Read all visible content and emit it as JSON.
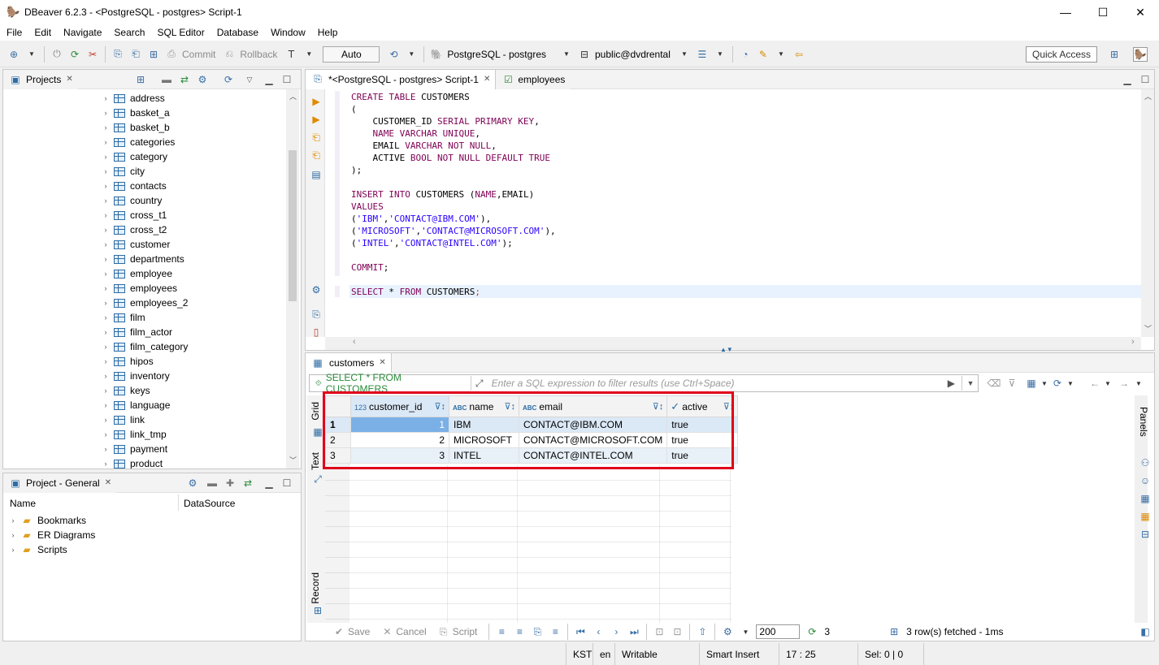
{
  "window": {
    "title": "DBeaver 6.2.3 - <PostgreSQL - postgres> Script-1",
    "minimize": "—",
    "maximize": "☐",
    "close": "✕"
  },
  "menu": [
    "File",
    "Edit",
    "Navigate",
    "Search",
    "SQL Editor",
    "Database",
    "Window",
    "Help"
  ],
  "toolbar": {
    "commit": "Commit",
    "rollback": "Rollback",
    "mode": "Auto",
    "connection": "PostgreSQL - postgres",
    "schema": "public@dvdrental",
    "quick_access": "Quick Access"
  },
  "projects_panel": {
    "tab": "Projects",
    "tables": [
      "address",
      "basket_a",
      "basket_b",
      "categories",
      "category",
      "city",
      "contacts",
      "country",
      "cross_t1",
      "cross_t2",
      "customer",
      "departments",
      "employee",
      "employees",
      "employees_2",
      "film",
      "film_actor",
      "film_category",
      "hipos",
      "inventory",
      "keys",
      "language",
      "link",
      "link_tmp",
      "payment",
      "product"
    ]
  },
  "project_general": {
    "tab": "Project - General",
    "col_name": "Name",
    "col_datasource": "DataSource",
    "items": [
      "Bookmarks",
      "ER Diagrams",
      "Scripts"
    ]
  },
  "editor": {
    "tab_script": "*<PostgreSQL - postgres> Script-1",
    "tab_employees": "employees"
  },
  "results": {
    "tab": "customers",
    "filter_query": "SELECT * FROM CUSTOMERS",
    "filter_placeholder": "Enter a SQL expression to filter results (use Ctrl+Space)",
    "side_tabs": {
      "grid": "Grid",
      "text": "Text",
      "record": "Record",
      "panels": "Panels"
    },
    "columns": [
      {
        "type": "123",
        "name": "customer_id"
      },
      {
        "type": "ABC",
        "name": "name"
      },
      {
        "type": "ABC",
        "name": "email"
      },
      {
        "type": "✓",
        "name": "active"
      }
    ],
    "rows": [
      {
        "num": "1",
        "customer_id": "1",
        "name": "IBM",
        "email": "CONTACT@IBM.COM",
        "active": "true"
      },
      {
        "num": "2",
        "customer_id": "2",
        "name": "MICROSOFT",
        "email": "CONTACT@MICROSOFT.COM",
        "active": "true"
      },
      {
        "num": "3",
        "customer_id": "3",
        "name": "INTEL",
        "email": "CONTACT@INTEL.COM",
        "active": "true"
      }
    ],
    "bottom": {
      "save": "Save",
      "cancel": "Cancel",
      "script": "Script",
      "fetch_size": "200",
      "row_count": "3",
      "fetched": "3 row(s) fetched - 1ms"
    }
  },
  "statusbar": {
    "tz": "KST",
    "lang": "en",
    "mode": "Writable",
    "insert": "Smart Insert",
    "pos": "17 : 25",
    "sel": "Sel: 0 | 0"
  },
  "colors": {
    "keyword": "#7f0055",
    "string": "#2a00ff",
    "highlight_border": "#e0001a",
    "selected_row": "#7ab0e6"
  }
}
